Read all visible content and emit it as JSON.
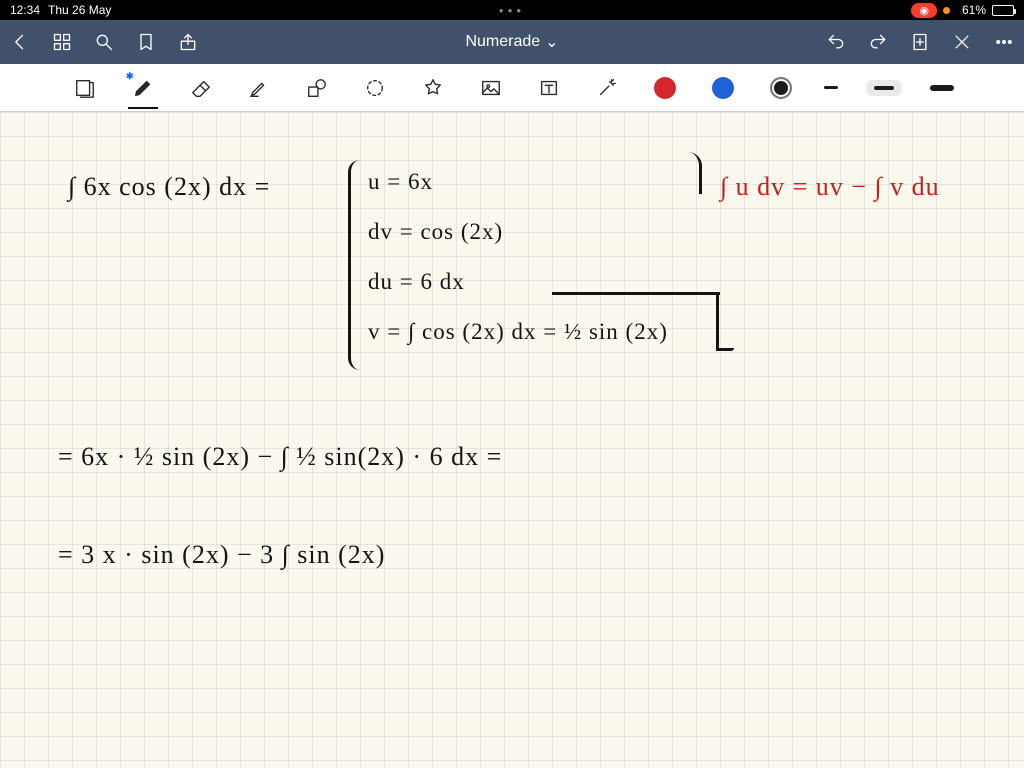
{
  "status": {
    "time": "12:34",
    "date": "Thu 26 May",
    "recording": "◉",
    "battery_pct": "61%",
    "battery_level_css": "61%"
  },
  "navbar": {
    "title": "Numerade",
    "dropdown_glyph": "⌄"
  },
  "toolbar": {
    "active_tool": "pen",
    "active_color": "black",
    "active_stroke": "md"
  },
  "notes": {
    "line1a": "∫ 6x cos (2x) dx  =",
    "sub_u": "u = 6x",
    "sub_dv": "dv = cos (2x)",
    "sub_du": "du = 6 dx",
    "sub_v": "v = ∫ cos (2x) dx = ½ sin (2x)",
    "formula": "∫ u dv = uv − ∫ v du",
    "line2": "=  6x · ½ sin (2x) − ∫ ½ sin(2x) · 6 dx  =",
    "line3": "=  3 x · sin (2x) − 3 ∫ sin (2x)"
  },
  "colors": {
    "navbar": "#41506b",
    "paper": "#fbf8ee",
    "ink": "#141414",
    "ink_red": "#c4211e",
    "swatch_red": "#d7262b",
    "swatch_blue": "#1e63d6"
  }
}
